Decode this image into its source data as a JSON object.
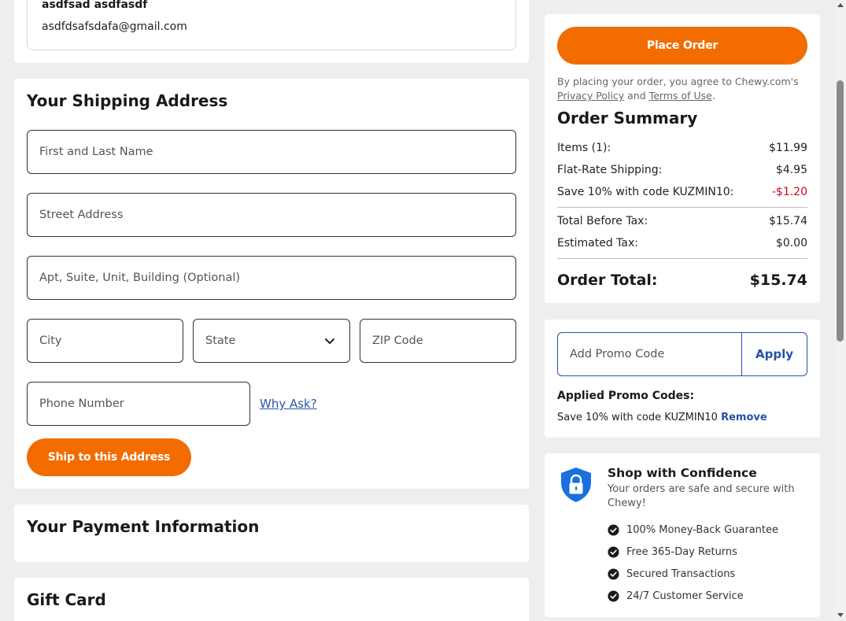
{
  "contact": {
    "name": "asdfsad asdfasdf",
    "email": "asdfdsafsdafa@gmail.com"
  },
  "shipping": {
    "title": "Your Shipping Address",
    "name_placeholder": "First and Last Name",
    "street_placeholder": "Street Address",
    "apt_placeholder": "Apt, Suite, Unit, Building (Optional)",
    "city_placeholder": "City",
    "state_label": "State",
    "zip_placeholder": "ZIP Code",
    "phone_placeholder": "Phone Number",
    "why_ask": "Why Ask?",
    "ship_button": "Ship to this Address"
  },
  "payment": {
    "title": "Your Payment Information"
  },
  "gift_card": {
    "title": "Gift Card"
  },
  "summary": {
    "place_order": "Place Order",
    "agree_prefix": "By placing your order, you agree to Chewy.com's",
    "privacy_link": "Privacy Policy",
    "and": "and",
    "terms_link": "Terms of Use",
    "period": ".",
    "title": "Order Summary",
    "rows": [
      {
        "label": "Items (1):",
        "value": "$11.99"
      },
      {
        "label": "Flat-Rate Shipping:",
        "value": "$4.95"
      },
      {
        "label": "Save 10% with code KUZMIN10:",
        "value": "-$1.20"
      },
      {
        "label": "Total Before Tax:",
        "value": "$15.74"
      },
      {
        "label": "Estimated Tax:",
        "value": "$0.00"
      },
      {
        "label": "Order Total:",
        "value": "$15.74"
      }
    ],
    "discount_color": "#d0021b"
  },
  "promo": {
    "placeholder": "Add Promo Code",
    "apply": "Apply",
    "applied_label": "Applied Promo Codes:",
    "applied_code": "Save 10% with code KUZMIN10",
    "remove": "Remove"
  },
  "confidence": {
    "title": "Shop with Confidence",
    "subtitle": "Your orders are safe and secure with Chewy!",
    "items": [
      "100% Money-Back Guarantee",
      "Free 365-Day Returns",
      "Secured Transactions",
      "24/7 Customer Service"
    ]
  },
  "colors": {
    "accent": "#f26c00",
    "link": "#2553a8",
    "shield": "#1a6fe0"
  }
}
